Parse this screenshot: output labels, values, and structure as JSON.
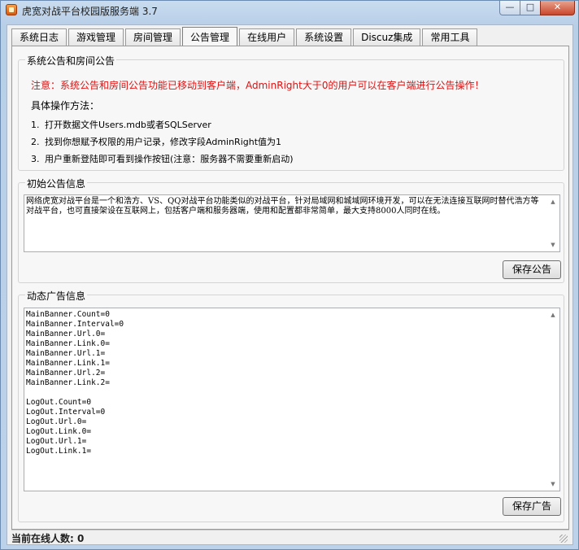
{
  "window": {
    "title": "虎宽对战平台校园版服务端 3.7",
    "controls": {
      "minimize": "—",
      "maximize": "□",
      "close": "✕"
    }
  },
  "tabs": [
    {
      "label": "系统日志",
      "active": false
    },
    {
      "label": "游戏管理",
      "active": false
    },
    {
      "label": "房间管理",
      "active": false
    },
    {
      "label": "公告管理",
      "active": true
    },
    {
      "label": "在线用户",
      "active": false
    },
    {
      "label": "系统设置",
      "active": false
    },
    {
      "label": "Discuz集成",
      "active": false
    },
    {
      "label": "常用工具",
      "active": false
    }
  ],
  "system_notice_group": {
    "title": "系统公告和房间公告",
    "notice": "注意：系统公告和房间公告功能已移动到客户端，AdminRight大于0的用户可以在客户端进行公告操作！",
    "steps_title": "具体操作方法：",
    "steps": [
      {
        "num": "1.",
        "text": "打开数据文件Users.mdb或者SQLServer"
      },
      {
        "num": "2.",
        "text": "找到你想赋予权限的用户记录，修改字段AdminRight值为1"
      },
      {
        "num": "3.",
        "text": "用户重新登陆即可看到操作按钮(注意：服务器不需要重新启动)"
      }
    ],
    "notice_color": "#e01010"
  },
  "initial_notice_group": {
    "title": "初始公告信息",
    "text": "网络虎宽对战平台是一个和浩方、VS、QQ对战平台功能类似的对战平台，针对局域网和城域网环境开发，可以在无法连接互联网时替代浩方等对战平台，也可直接架设在互联网上，包括客户端和服务器端，使用和配置都非常简单，最大支持8000人同时在线。",
    "save_label": "保存公告"
  },
  "ad_group": {
    "title": "动态广告信息",
    "text": "MainBanner.Count=0\nMainBanner.Interval=0\nMainBanner.Url.0=\nMainBanner.Link.0=\nMainBanner.Url.1=\nMainBanner.Link.1=\nMainBanner.Url.2=\nMainBanner.Link.2=\n\nLogOut.Count=0\nLogOut.Interval=0\nLogOut.Url.0=\nLogOut.Link.0=\nLogOut.Url.1=\nLogOut.Link.1=",
    "save_label": "保存广告"
  },
  "status_bar": {
    "text": "当前在线人数: 0"
  }
}
